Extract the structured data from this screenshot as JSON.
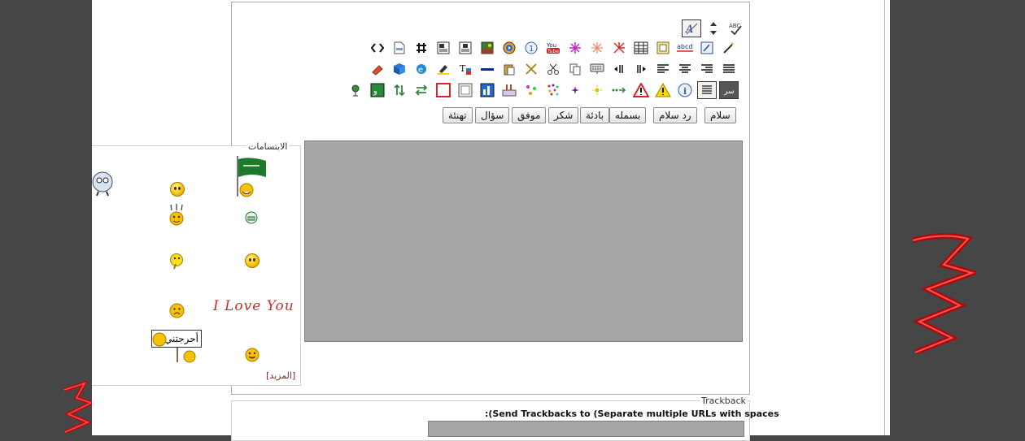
{
  "colors": {
    "page_bg": "#464646",
    "content_bg": "#ffffff",
    "textarea_bg": "#a8a5a7",
    "link": "#8b1e1e"
  },
  "toolbar": {
    "row1": [
      "font-size-icon",
      "resize-icon",
      "spellcheck-icon"
    ],
    "row2": [
      "code-icon",
      "file-icon",
      "hash-icon",
      "image-left-icon",
      "image-center-icon",
      "photo-icon",
      "media-icon",
      "counter-icon",
      "youtube-icon",
      "flash-icon",
      "sparkle-icon",
      "fireworks-icon",
      "table-icon",
      "frame-icon",
      "text-box-icon",
      "note-icon",
      "wand-icon"
    ],
    "row3": [
      "eraser-icon",
      "book-icon",
      "ie-icon",
      "highlight-icon",
      "text-color-icon",
      "hr-icon",
      "paste-icon",
      "cut-x-icon",
      "scissors-icon",
      "copy-icon",
      "keyboard-icon",
      "ltr-icon",
      "rtl-icon",
      "align-left-icon",
      "align-center-icon",
      "align-right-icon",
      "justify-icon"
    ],
    "row4": [
      "mail-icon",
      "quote-icon",
      "arrows-ud-icon",
      "arrows-lr-icon",
      "border-box-icon",
      "shadow-box-icon",
      "chart-icon",
      "cake-icon",
      "stars-icon",
      "confetti-icon",
      "star-small-icon",
      "sun-icon",
      "arrow-dots-icon",
      "warning-red-icon",
      "warning-yellow-icon",
      "info-icon",
      "list-icon",
      "secret-icon"
    ]
  },
  "phrases": [
    "سلام",
    "رد سلام",
    "بسمله",
    "بادئة",
    "شكر",
    "موفق",
    "سؤال",
    "تهنئة"
  ],
  "smilies": {
    "legend": "الابتسامات",
    "love_text": "I Love You",
    "sign_text": "أحرجتني",
    "more_link": "[المزيد]"
  },
  "trackback": {
    "legend": "Trackback",
    "label": ":(Send Trackbacks to (Separate multiple URLs with spaces"
  }
}
